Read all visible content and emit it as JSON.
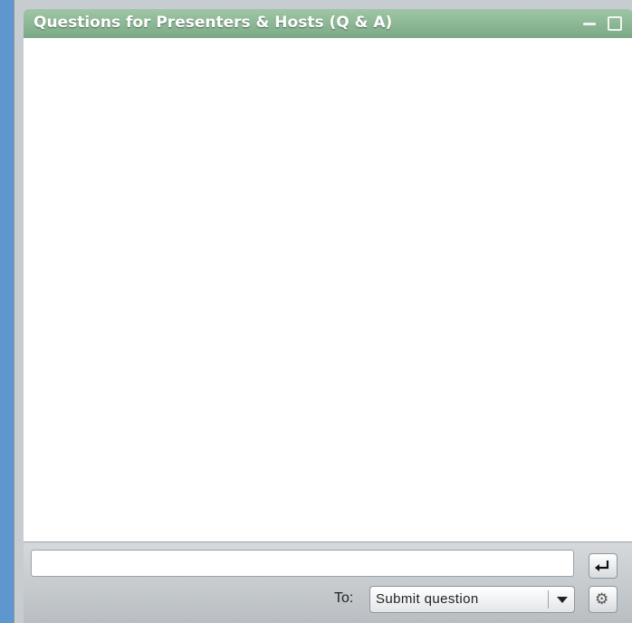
{
  "panel": {
    "title": "Questions for Presenters & Hosts (Q & A)",
    "window_controls": [
      "minimize-icon",
      "maximize-icon"
    ]
  },
  "question_input": {
    "value": "",
    "placeholder": ""
  },
  "send_button": {
    "icon": "enter-arrow-icon"
  },
  "recipient": {
    "label": "To:",
    "selected": "Submit question"
  },
  "options_button": {
    "icon": "gear-icon"
  },
  "colors": {
    "titlebar": "#8fb996",
    "background": "#5e96cf",
    "frame": "#c7ccd0",
    "content": "#ffffff"
  }
}
